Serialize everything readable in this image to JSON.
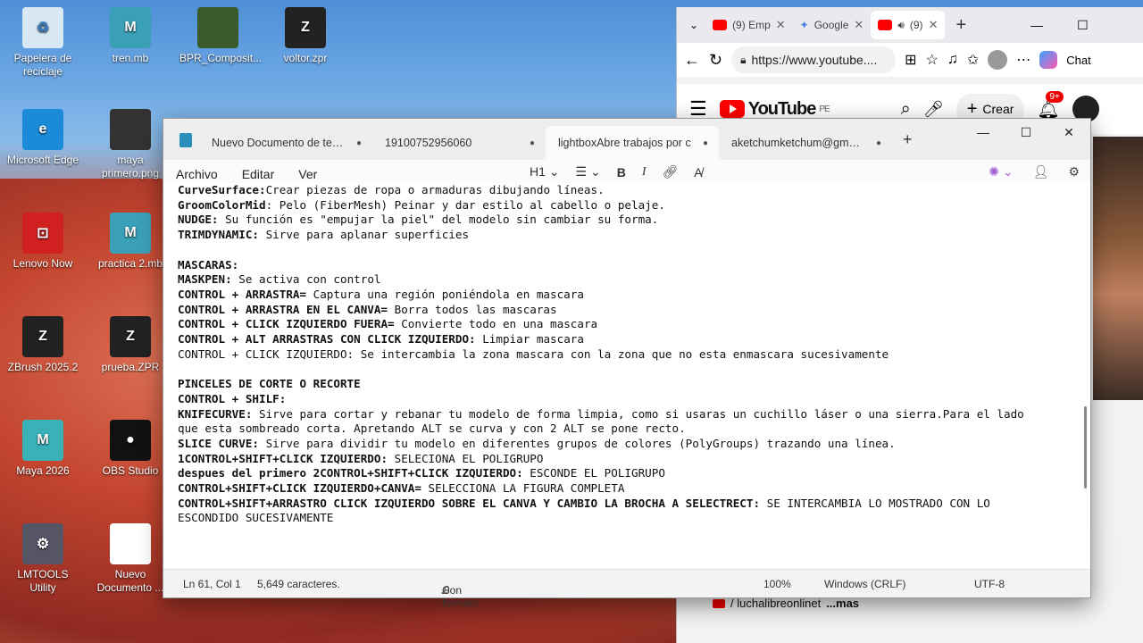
{
  "desktop": {
    "icons": [
      {
        "label": "Papelera de reciclaje",
        "glyph": "♻",
        "color": "#d8e8f4",
        "icon": "recycle-bin-icon"
      },
      {
        "label": "tren.mb",
        "glyph": "M",
        "color": "#3aa0b8",
        "icon": "maya-file-icon"
      },
      {
        "label": "BPR_Composit...",
        "glyph": "",
        "color": "#3a5a2a",
        "icon": "image-thumbnail-icon"
      },
      {
        "label": "voltor.zpr",
        "glyph": "Z",
        "color": "#222",
        "icon": "zbrush-project-icon"
      },
      {
        "label": "Microsoft Edge",
        "glyph": "e",
        "color": "#1b8ad8",
        "icon": "edge-icon"
      },
      {
        "label": "maya primero.png",
        "glyph": "",
        "color": "#333",
        "icon": "image-thumbnail-icon"
      },
      {
        "label": "Lenovo Now",
        "glyph": "⊡",
        "color": "#d02020",
        "icon": "lenovo-now-icon"
      },
      {
        "label": "practica 2.mb",
        "glyph": "M",
        "color": "#3aa0b8",
        "icon": "maya-file-icon"
      },
      {
        "label": "ZBrush 2025.2",
        "glyph": "Z",
        "color": "#222",
        "icon": "zbrush-icon"
      },
      {
        "label": "prueba.ZPR",
        "glyph": "Z",
        "color": "#222",
        "icon": "zbrush-project-icon"
      },
      {
        "label": "Maya 2026",
        "glyph": "M",
        "color": "#3ab0b8",
        "icon": "maya-app-icon"
      },
      {
        "label": "OBS Studio",
        "glyph": "●",
        "color": "#111",
        "icon": "obs-icon"
      },
      {
        "label": "LMTOOLS Utility",
        "glyph": "⚙",
        "color": "#556",
        "icon": "lmtools-icon"
      },
      {
        "label": "Nuevo Documento ...",
        "glyph": "",
        "color": "#fff",
        "icon": "text-file-icon"
      }
    ]
  },
  "browser": {
    "tabs": [
      {
        "label": "(9) Emp"
      },
      {
        "label": "Google"
      },
      {
        "label": "(9)"
      }
    ],
    "url": "https://www.youtube....",
    "chat_label": "Chat",
    "yt_logo": "YouTube",
    "yt_region": "PE",
    "create_label": "Crear",
    "notif_badge": "9+",
    "channel_text": "/ luchalibreonlinet",
    "more_text": "...mas"
  },
  "notepad": {
    "tabs": [
      {
        "label": "Nuevo Documento de texto"
      },
      {
        "label": "19100752956060"
      },
      {
        "label": "lightboxAbre trabajos por c"
      },
      {
        "label": "aketchumketchum@gmail.c"
      }
    ],
    "menu": [
      "Archivo",
      "Editar",
      "Ver"
    ],
    "heading_label": "H1",
    "lines": [
      [
        {
          "b": "CurveSurface:"
        },
        {
          "t": "Crear piezas de ropa o armaduras dibujando líneas."
        }
      ],
      [
        {
          "b": "GroomColorMid"
        },
        {
          "t": ": Pelo (FiberMesh) Peinar y dar estilo al cabello o pelaje."
        }
      ],
      [
        {
          "b": "NUDGE:"
        },
        {
          "t": " Su función es \"empujar la piel\" del modelo sin cambiar su forma."
        }
      ],
      [
        {
          "b": "TRIMDYNAMIC:"
        },
        {
          "t": " Sirve para aplanar superficies"
        }
      ],
      [],
      [
        {
          "b": "MASCARAS:"
        }
      ],
      [
        {
          "b": "MASKPEN:"
        },
        {
          "t": " Se activa con control"
        }
      ],
      [
        {
          "b": "CONTROL + ARRASTRA="
        },
        {
          "t": " Captura una región poniéndola en mascara"
        }
      ],
      [
        {
          "b": "CONTROL + ARRASTRA EN EL CANVA="
        },
        {
          "t": " Borra todos las mascaras"
        }
      ],
      [
        {
          "b": "CONTROL + CLICK IZQUIERDO FUERA="
        },
        {
          "t": " Convierte todo en una mascara"
        }
      ],
      [
        {
          "b": "CONTROL + ALT ARRASTRAS CON CLICK IZQUIERDO:"
        },
        {
          "t": " Limpiar mascara"
        }
      ],
      [
        {
          "t": "CONTROL + CLICK IZQUIERDO: Se intercambia la zona mascara con la zona que no esta enmascara sucesivamente"
        }
      ],
      [],
      [
        {
          "b": "PINCELES DE CORTE O RECORTE"
        }
      ],
      [
        {
          "b": "CONTROL + SHILF:"
        }
      ],
      [
        {
          "b": "KNIFECURVE:"
        },
        {
          "t": " Sirve para cortar y rebanar tu modelo de forma limpia, como si usaras un cuchillo láser o una sierra.Para el lado"
        }
      ],
      [
        {
          "t": "que esta sombreado corta. Apretando ALT se curva y con 2 ALT se pone recto."
        }
      ],
      [
        {
          "b": "SLICE CURVE:"
        },
        {
          "t": " Sirve para dividir tu modelo en diferentes grupos de colores (PolyGroups) trazando una línea."
        }
      ],
      [
        {
          "b": "1CONTROL+SHIFT+CLICK IZQUIERDO:"
        },
        {
          "t": " SELECIONA EL POLIGRUPO"
        }
      ],
      [
        {
          "b": "despues del primero 2CONTROL+SHIFT+CLICK IZQUIERDO:"
        },
        {
          "t": " ESCONDE EL POLIGRUPO"
        }
      ],
      [
        {
          "b": "CONTROL+SHIFT+CLICK IZQUIERDO+CANVA="
        },
        {
          "t": " SELECCIONA LA FIGURA COMPLETA"
        }
      ],
      [
        {
          "b": "CONTROL+SHIFT+ARRASTRO CLICK IZQUIERDO SOBRE EL CANVA Y CAMBIO LA BROCHA A SELECTRECT:"
        },
        {
          "t": " SE INTERCAMBIA LO MOSTRADO CON LO"
        }
      ],
      [
        {
          "t": "ESCONDIDO SUCESIVAMENTE"
        }
      ]
    ],
    "status": {
      "position": "Ln 61, Col 1",
      "chars": "5,649 caracteres.",
      "format": "Con formato",
      "zoom": "100%",
      "eol": "Windows (CRLF)",
      "encoding": "UTF-8"
    }
  }
}
